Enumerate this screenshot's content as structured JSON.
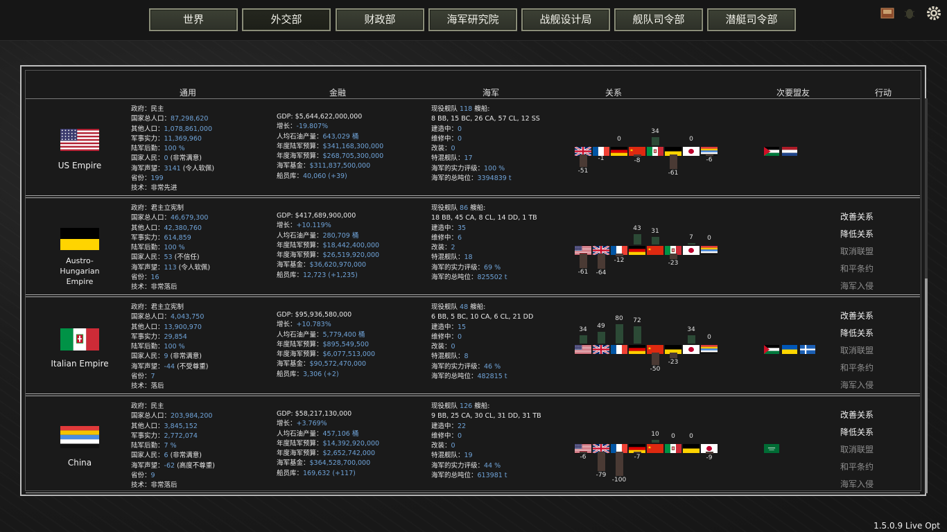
{
  "nav": [
    "世界",
    "外交部",
    "财政部",
    "海军研究院",
    "战舰设计局",
    "舰队司令部",
    "潜艇司令部"
  ],
  "nav_active": 1,
  "icons": [
    "book-icon",
    "bug-icon",
    "gear-icon"
  ],
  "headers": {
    "general": "通用",
    "finance": "金融",
    "navy": "海军",
    "relations": "关系",
    "minor_allies": "次要盟友",
    "actions": "行动"
  },
  "version": "1.5.0.9 Live Opt",
  "countries": [
    {
      "name": "US Empire",
      "general": [
        [
          "政府：",
          "民主"
        ],
        [
          "国家总人口：",
          "87,298,620"
        ],
        [
          "其他人口：",
          "1,078,861,000"
        ],
        [
          "军事实力：",
          "11,369,960"
        ],
        [
          "陆军后勤：",
          "100 %"
        ],
        [
          "国家人民：",
          "0 (非常满意)"
        ],
        [
          "海军声望：",
          "3141 (令人软佩)"
        ],
        [
          "省份：",
          "199"
        ],
        [
          "技术：",
          "非常先进"
        ]
      ],
      "finance": [
        [
          "GDP: ",
          "$5,644,622,000,000"
        ],
        [
          "增长：",
          "-19.807%"
        ],
        [
          "人均石油产量：",
          "643,029 桶"
        ],
        [
          "年度陆军预算：",
          "$341,168,300,000"
        ],
        [
          "年度海军预算：",
          "$268,705,300,000"
        ],
        [
          "海军基金：",
          "$311,837,500,000"
        ],
        [
          "船员库：",
          "40,060 (+39)"
        ]
      ],
      "navy": [
        [
          "现役舰队 ",
          "118",
          " 艘船:"
        ],
        [
          "8 BB, 15 BC, 26 CA, 57 CL, 12 SS",
          ""
        ],
        [
          "建造中：",
          "0"
        ],
        [
          "维修中：",
          "0"
        ],
        [
          "改装：",
          "0"
        ],
        [
          "特混舰队：",
          "17"
        ],
        [
          "海军的实力评级：",
          "100 %"
        ],
        [
          "海军的总吨位：",
          "3394839 t"
        ]
      ],
      "relations": [
        {
          "flag": "uk",
          "value": -51
        },
        {
          "flag": "fr",
          "value": -1
        },
        {
          "flag": "de",
          "value": 0
        },
        {
          "flag": "cn_red",
          "value": -8
        },
        {
          "flag": "it",
          "value": 34
        },
        {
          "flag": "at",
          "value": -61
        },
        {
          "flag": "jp",
          "value": 0
        },
        {
          "flag": "cn",
          "value": -6
        }
      ],
      "allies": [
        "jo",
        "nl"
      ],
      "actions": []
    },
    {
      "name": "Austro-Hungarian Empire",
      "name_lines": [
        "Austro-",
        "Hungarian",
        "Empire"
      ],
      "general": [
        [
          "政府：",
          "君主立宪制"
        ],
        [
          "国家总人口：",
          "46,679,300"
        ],
        [
          "其他人口：",
          "42,380,760"
        ],
        [
          "军事实力：",
          "614,859"
        ],
        [
          "陆军后勤：",
          "100 %"
        ],
        [
          "国家人民：",
          "53 (不信任)"
        ],
        [
          "海军声望：",
          "113 (令人软佩)"
        ],
        [
          "省份：",
          "16"
        ],
        [
          "技术：",
          "非常落后"
        ]
      ],
      "finance": [
        [
          "GDP: ",
          "$417,689,900,000"
        ],
        [
          "增长：",
          "+10.119%"
        ],
        [
          "人均石油产量：",
          "280,709 桶"
        ],
        [
          "年度陆军预算：",
          "$18,442,400,000"
        ],
        [
          "年度海军预算：",
          "$26,519,920,000"
        ],
        [
          "海军基金：",
          "$36,620,970,000"
        ],
        [
          "船员库：",
          "12,723 (+1,235)"
        ]
      ],
      "navy": [
        [
          "现役舰队 ",
          "86",
          " 艘船:"
        ],
        [
          "18 BB, 45 CA, 8 CL, 14 DD, 1 TB",
          ""
        ],
        [
          "建造中：",
          "35"
        ],
        [
          "维修中：",
          "6"
        ],
        [
          "改装：",
          "2"
        ],
        [
          "特混舰队：",
          "18"
        ],
        [
          "海军的实力评级：",
          "69 %"
        ],
        [
          "海军的总吨位：",
          "825502 t"
        ]
      ],
      "relations": [
        {
          "flag": "us",
          "value": -61
        },
        {
          "flag": "uk",
          "value": -64
        },
        {
          "flag": "fr",
          "value": -12
        },
        {
          "flag": "de",
          "value": 43
        },
        {
          "flag": "cn_red",
          "value": 31
        },
        {
          "flag": "it",
          "value": -23
        },
        {
          "flag": "jp",
          "value": 7
        },
        {
          "flag": "cn",
          "value": 0
        }
      ],
      "allies": [],
      "actions": [
        [
          "改善关系",
          true
        ],
        [
          "降低关系",
          true
        ],
        [
          "取消联盟",
          false
        ],
        [
          "和平条约",
          false
        ],
        [
          "海军入侵",
          false
        ]
      ]
    },
    {
      "name": "Italian Empire",
      "general": [
        [
          "政府：",
          "君主立宪制"
        ],
        [
          "国家总人口：",
          "4,043,750"
        ],
        [
          "其他人口：",
          "13,900,970"
        ],
        [
          "军事实力：",
          "29,854"
        ],
        [
          "陆军后勤：",
          "100 %"
        ],
        [
          "国家人民：",
          "9 (非常满意)"
        ],
        [
          "海军声望：",
          "-44 (不受尊重)"
        ],
        [
          "省份：",
          "7"
        ],
        [
          "技术：",
          "落后"
        ]
      ],
      "finance": [
        [
          "GDP: ",
          "$95,936,580,000"
        ],
        [
          "增长：",
          "+10.783%"
        ],
        [
          "人均石油产量：",
          "5,779,400 桶"
        ],
        [
          "年度陆军预算：",
          "$895,549,500"
        ],
        [
          "年度海军预算：",
          "$6,077,513,000"
        ],
        [
          "海军基金：",
          "$90,572,470,000"
        ],
        [
          "船员库：",
          "3,306 (+2)"
        ]
      ],
      "navy": [
        [
          "现役舰队 ",
          "48",
          " 艘船:"
        ],
        [
          "6 BB, 5 BC, 10 CA, 6 CL, 21 DD",
          ""
        ],
        [
          "建造中：",
          "15"
        ],
        [
          "维修中：",
          "0"
        ],
        [
          "改装：",
          "0"
        ],
        [
          "特混舰队：",
          "8"
        ],
        [
          "海军的实力评级：",
          "46 %"
        ],
        [
          "海军的总吨位：",
          "482815 t"
        ]
      ],
      "relations": [
        {
          "flag": "us",
          "value": 34
        },
        {
          "flag": "uk",
          "value": 49
        },
        {
          "flag": "fr",
          "value": 80
        },
        {
          "flag": "de",
          "value": 72
        },
        {
          "flag": "cn_red",
          "value": -50
        },
        {
          "flag": "at",
          "value": -23
        },
        {
          "flag": "jp",
          "value": 34
        },
        {
          "flag": "cn",
          "value": 0
        }
      ],
      "allies": [
        "ps",
        "ua",
        "fi"
      ],
      "actions": [
        [
          "改善关系",
          true
        ],
        [
          "降低关系",
          true
        ],
        [
          "取消联盟",
          false
        ],
        [
          "和平条约",
          false
        ],
        [
          "海军入侵",
          false
        ]
      ]
    },
    {
      "name": "China",
      "general": [
        [
          "政府：",
          "民主"
        ],
        [
          "国家总人口：",
          "203,984,200"
        ],
        [
          "其他人口：",
          "3,845,152"
        ],
        [
          "军事实力：",
          "2,772,074"
        ],
        [
          "陆军后勤：",
          "7 %"
        ],
        [
          "国家人民：",
          "6 (非常满意)"
        ],
        [
          "海军声望：",
          "-62 (高度不尊重)"
        ],
        [
          "省份：",
          "9"
        ],
        [
          "技术：",
          "非常落后"
        ]
      ],
      "finance": [
        [
          "GDP: ",
          "$58,217,130,000"
        ],
        [
          "增长：",
          "+3.769%"
        ],
        [
          "人均石油产量：",
          "457,106 桶"
        ],
        [
          "年度陆军预算：",
          "$14,392,920,000"
        ],
        [
          "年度海军预算：",
          "$2,652,742,000"
        ],
        [
          "海军基金：",
          "$364,528,700,000"
        ],
        [
          "船员库：",
          "169,632 (+117)"
        ]
      ],
      "navy": [
        [
          "现役舰队 ",
          "126",
          " 艘船:"
        ],
        [
          "9 BB, 25 CA, 30 CL, 31 DD, 31 TB",
          ""
        ],
        [
          "建造中：",
          "22"
        ],
        [
          "维修中：",
          "0"
        ],
        [
          "改装：",
          "0"
        ],
        [
          "特混舰队：",
          "19"
        ],
        [
          "海军的实力评级：",
          "44 %"
        ],
        [
          "海军的总吨位：",
          "613981 t"
        ]
      ],
      "relations": [
        {
          "flag": "us",
          "value": -6
        },
        {
          "flag": "uk",
          "value": -79
        },
        {
          "flag": "fr",
          "value": -100
        },
        {
          "flag": "de",
          "value": -7
        },
        {
          "flag": "cn_red",
          "value": 10
        },
        {
          "flag": "it",
          "value": 0
        },
        {
          "flag": "at",
          "value": 0
        },
        {
          "flag": "jp",
          "value": -9
        }
      ],
      "allies": [
        "sa"
      ],
      "actions": [
        [
          "改善关系",
          true
        ],
        [
          "降低关系",
          true
        ],
        [
          "取消联盟",
          false
        ],
        [
          "和平条约",
          false
        ],
        [
          "海军入侵",
          false
        ]
      ]
    }
  ]
}
